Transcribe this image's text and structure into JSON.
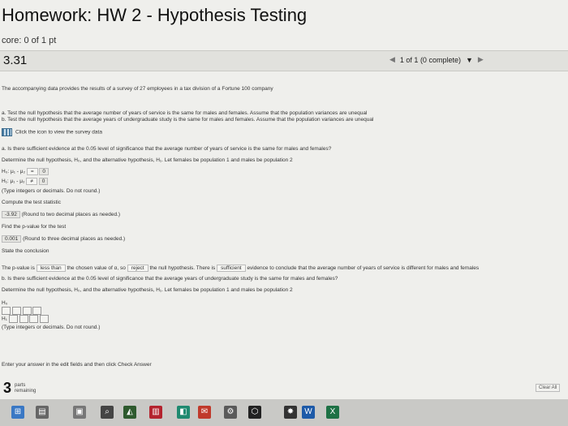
{
  "header": {
    "title": "Homework: HW 2 - Hypothesis Testing",
    "score": "core: 0 of 1 pt"
  },
  "question": {
    "number": "3.31",
    "progress": "1 of 1 (0 complete)",
    "progress_arrow": "▼"
  },
  "body": {
    "intro": "The accompanying data provides the results of a survey of 27 employees in a tax division of a Fortune 100 company",
    "part_a": "a. Test the null hypothesis that the average number of years of service is the same for males and females. Assume that the population variances are unequal",
    "part_b": "b. Test the null hypothesis that the average years of undergraduate study is the same for males and females. Assume that the population variances are unequal",
    "view_data": "Click the icon to view the survey data",
    "qa": "a. Is there sufficient evidence at the 0.05 level of significance that the average number of years of service is the same for males and females?",
    "determine": "Determine the null hypothesis, H₀, and the alternative hypothesis, H₁. Let females be population 1 and males be population 2",
    "h0": "H₀: μ₁ - μ₂",
    "h0_op": "=",
    "h0_val": "0",
    "h1": "H₁: μ₁ - μ₂",
    "h1_op": "≠",
    "h1_val": "0",
    "type_int": "(Type integers or decimals. Do not round.)",
    "compute": "Compute the test statistic",
    "stat_val": "-3.92",
    "round2": "(Round to two decimal places as needed.)",
    "find_p": "Find the p-value for the test",
    "p_val": "0.001",
    "round3": "(Round to three decimal places as needed.)",
    "state": "State the conclusion",
    "conc_1": "The p-value is",
    "conc_sel1": "less than",
    "conc_2": "the chosen value of α, so",
    "conc_sel2": "reject",
    "conc_3": "the null hypothesis. There is",
    "conc_sel3": "sufficient",
    "conc_4": "evidence to conclude that the average number of years of service is different for males and females",
    "qb": "b. Is there sufficient evidence at the 0.05 level of significance that the average years of undergraduate study is the same for males and females?",
    "determine_b": "Determine the null hypothesis, H₀, and the alternative hypothesis, H₁. Let females be population 1 and males be population 2",
    "h0b": "H₀",
    "h1b": "H₁",
    "type_int_b": "(Type integers or decimals. Do not round.)",
    "enter": "Enter your answer in the edit fields and then click Check Answer"
  },
  "footer": {
    "parts_num": "3",
    "parts_label_1": "parts",
    "parts_label_2": "remaining",
    "clear_all": "Clear All"
  },
  "colors": {
    "highlight": "#e6e6e2"
  }
}
